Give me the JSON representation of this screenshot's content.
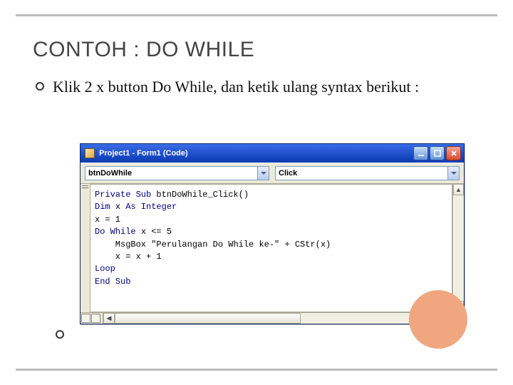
{
  "slide": {
    "title": "CONTOH : DO WHILE",
    "bullet1": "Klik 2 x button Do While, dan ketik ulang syntax berikut :"
  },
  "window": {
    "title": "Project1 - Form1 (Code)",
    "object_combo": "btnDoWhile",
    "event_combo": "Click"
  },
  "code": {
    "l1a": "Private Sub ",
    "l1b": "btnDoWhile_Click()",
    "l2a": "Dim ",
    "l2b": "x ",
    "l2c": "As Integer",
    "l3": "x = 1",
    "l4a": "Do While ",
    "l4b": "x <= 5",
    "l5a": "    MsgBox ",
    "l5b": "\"Perulangan Do While ke-\" + CStr(x)",
    "l6": "    x = x + 1",
    "l7": "Loop",
    "l8": "End Sub"
  }
}
